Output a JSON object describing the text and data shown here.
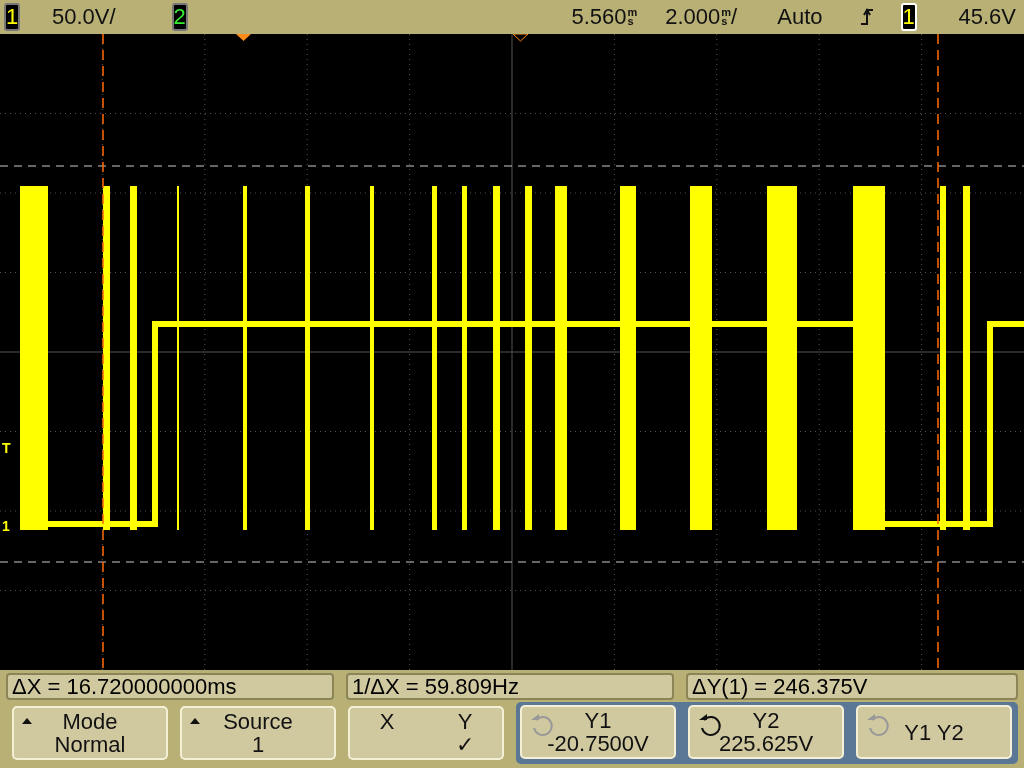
{
  "status_bar": {
    "channels": [
      {
        "number": "1"
      },
      {
        "number": "2"
      }
    ],
    "scale": "50.0V/",
    "delay": {
      "value": "5.560",
      "unit_top": "m",
      "unit_bottom": "s"
    },
    "timebase": {
      "value": "2.000",
      "unit_top": "m",
      "unit_bottom": "s",
      "suffix": "/"
    },
    "trigger_mode": "Auto",
    "trigger_rising": true,
    "trigger_source": {
      "number": "1"
    },
    "trigger_level": "45.6V"
  },
  "display": {
    "markers": [
      {
        "kind": "trigger",
        "label": "T"
      },
      {
        "kind": "ground",
        "label": "1"
      }
    ]
  },
  "measurements": [
    "ΔX = 16.720000000ms",
    "1/ΔX = 59.809Hz",
    "ΔY(1) = 246.375V"
  ],
  "softkeys": [
    {
      "kind": "menu",
      "label": "Mode",
      "value": "Normal"
    },
    {
      "kind": "menu",
      "label": "Source",
      "value": "1"
    },
    {
      "kind": "xy",
      "options": [
        {
          "label": "X",
          "selected": false
        },
        {
          "label": "Y",
          "selected": true
        }
      ],
      "check": "✓"
    }
  ],
  "knob_keys": [
    {
      "label": "Y1",
      "value": "-20.7500V",
      "active": false
    },
    {
      "label": "Y2",
      "value": "225.625V",
      "active": true
    },
    {
      "label": "Y1 Y2",
      "active": false
    }
  ]
}
